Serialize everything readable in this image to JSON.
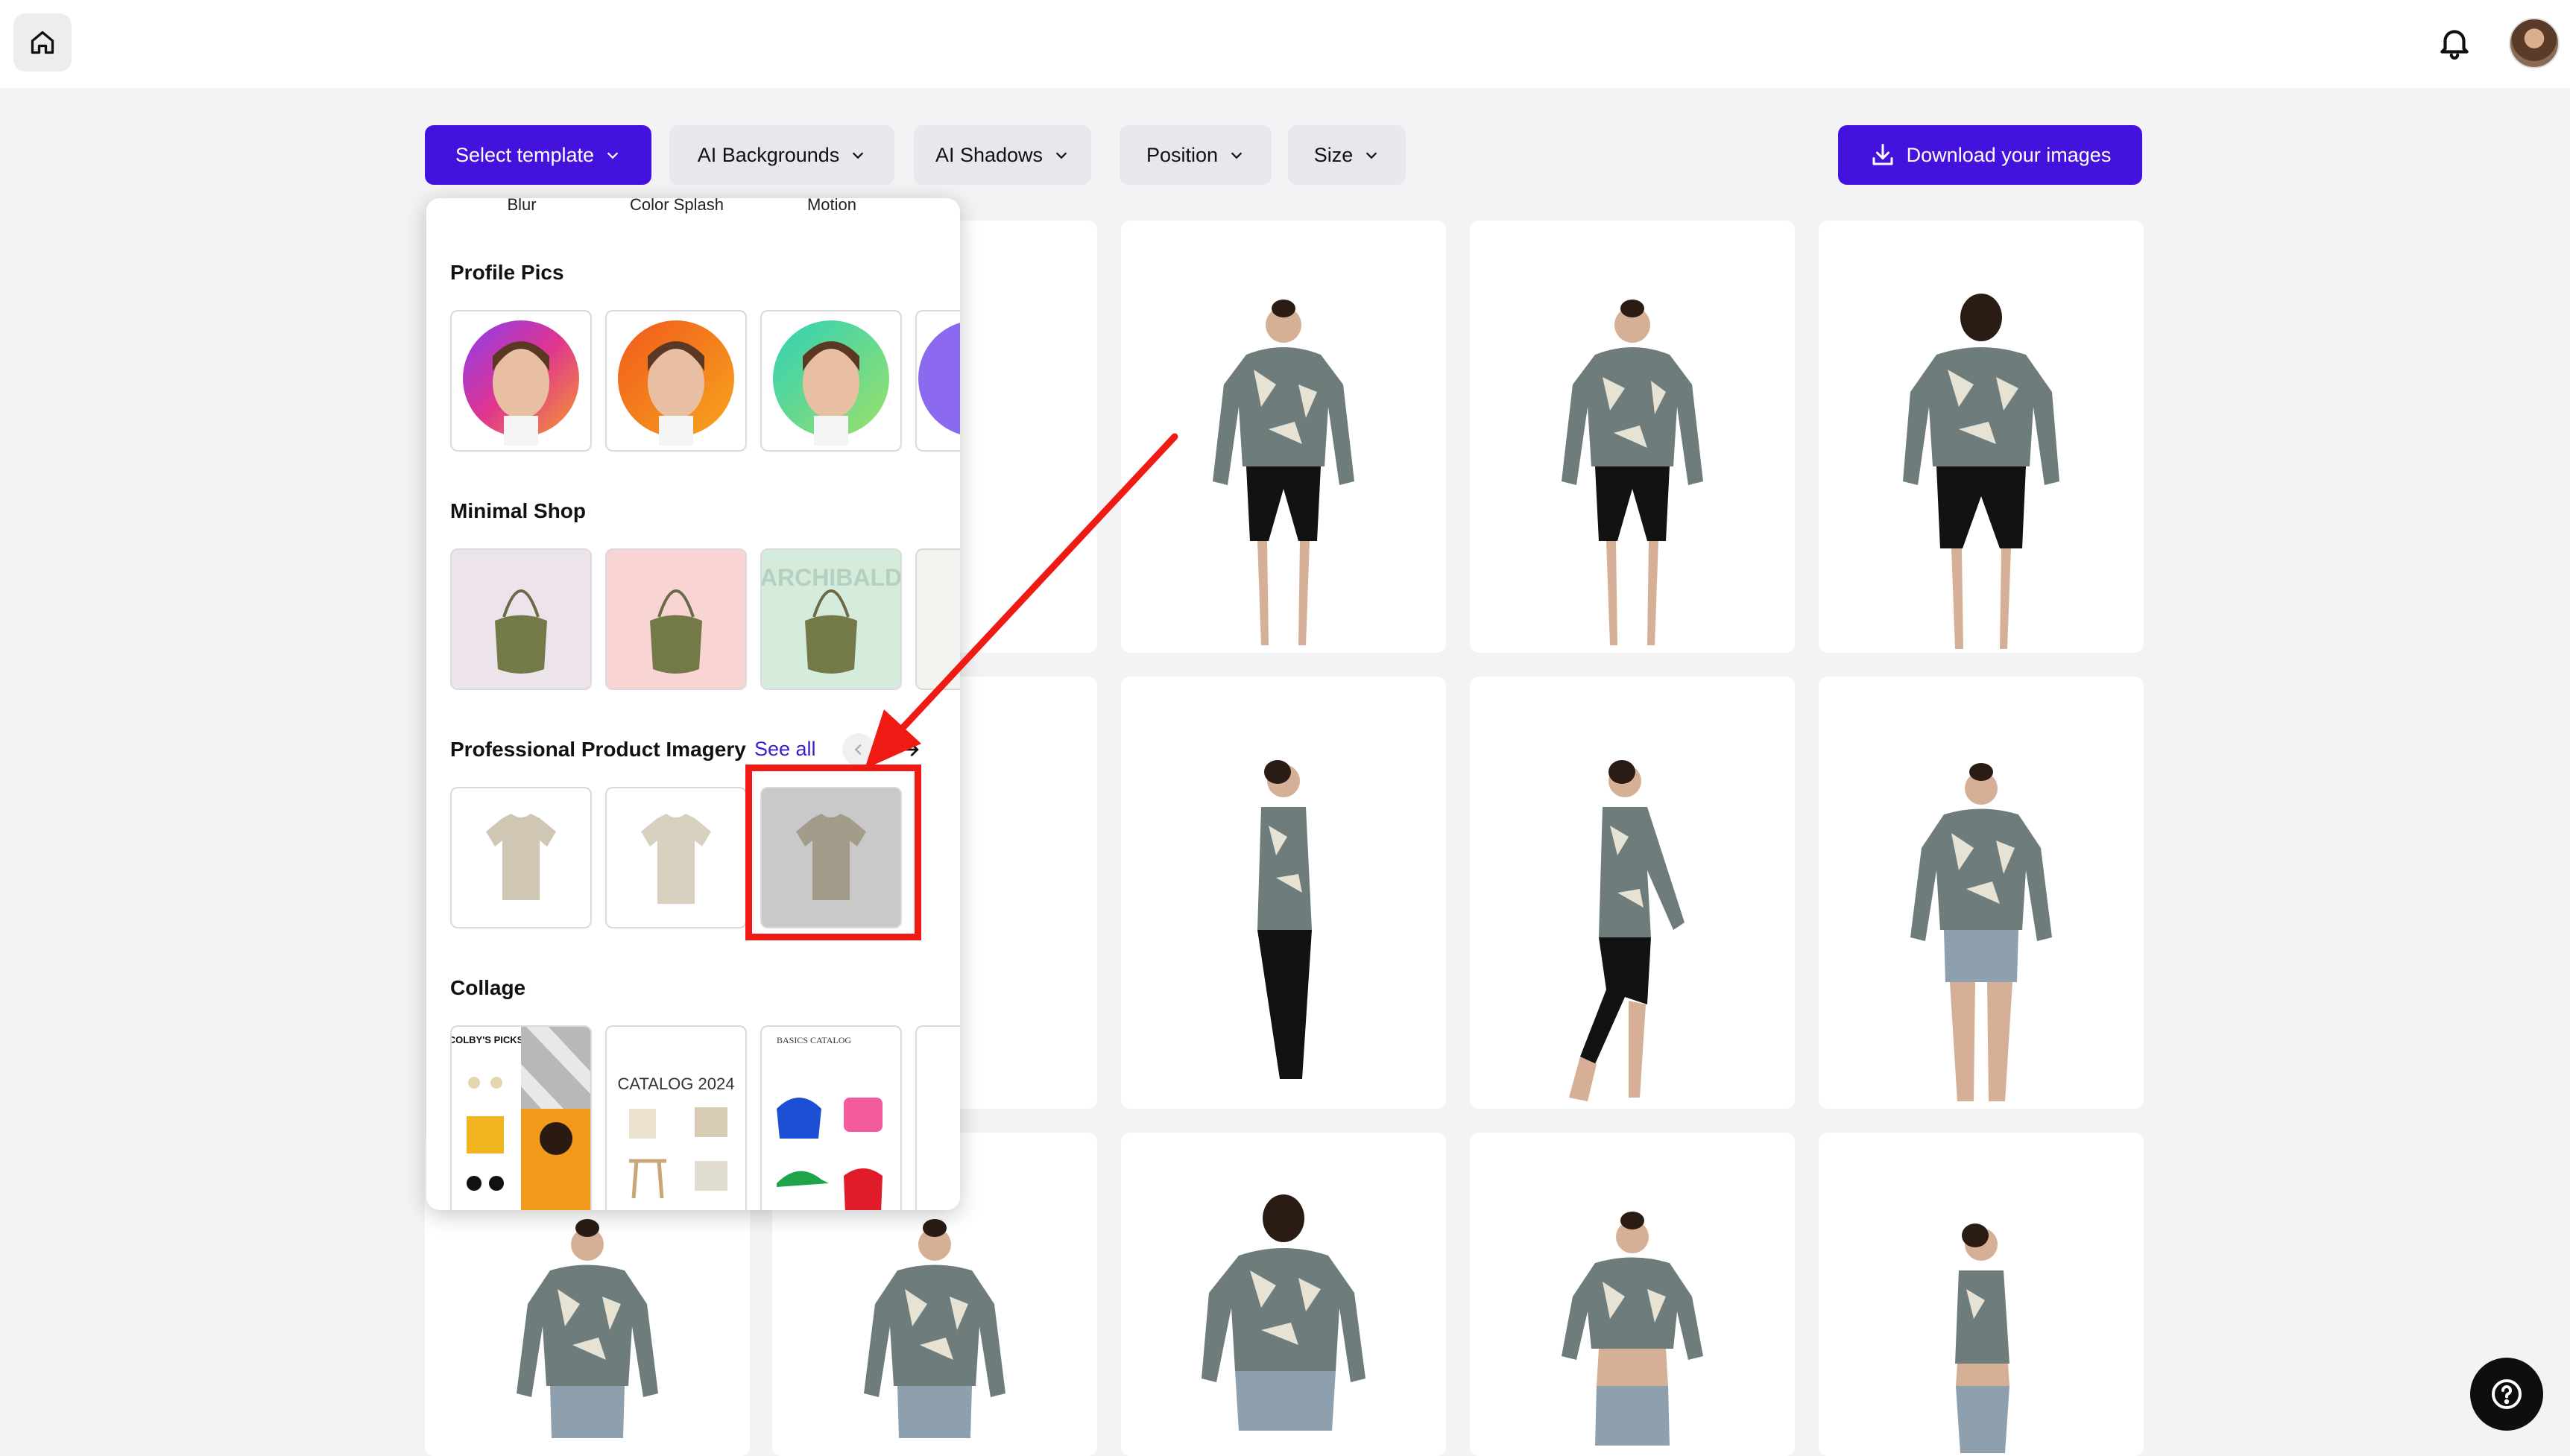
{
  "toolbar": {
    "select_template": "Select template",
    "ai_backgrounds": "AI Backgrounds",
    "ai_shadows": "AI Shadows",
    "position": "Position",
    "size": "Size",
    "download": "Download your images"
  },
  "dropdown": {
    "top_categories": [
      "Blur",
      "Color Splash",
      "Motion"
    ],
    "profile_pics": {
      "title": "Profile Pics",
      "backdrops": [
        "#e0358f",
        "#f26a1b",
        "#3fd6a4"
      ]
    },
    "minimal_shop": {
      "title": "Minimal Shop",
      "backgrounds": [
        "#ece4ea",
        "#f8d4d2",
        "#d5ecdd"
      ],
      "watermark": "ARCHIBALD"
    },
    "professional": {
      "title": "Professional Product Imagery",
      "see_all": "See all"
    },
    "collage": {
      "title": "Collage",
      "thumb1_text": "COLBY'S PICKS",
      "thumb2_text": "CATALOG 2024",
      "thumb3_text": "BASICS CATALOG"
    }
  },
  "colors": {
    "accent": "#4412dd",
    "annotation": "#ef1a13"
  }
}
